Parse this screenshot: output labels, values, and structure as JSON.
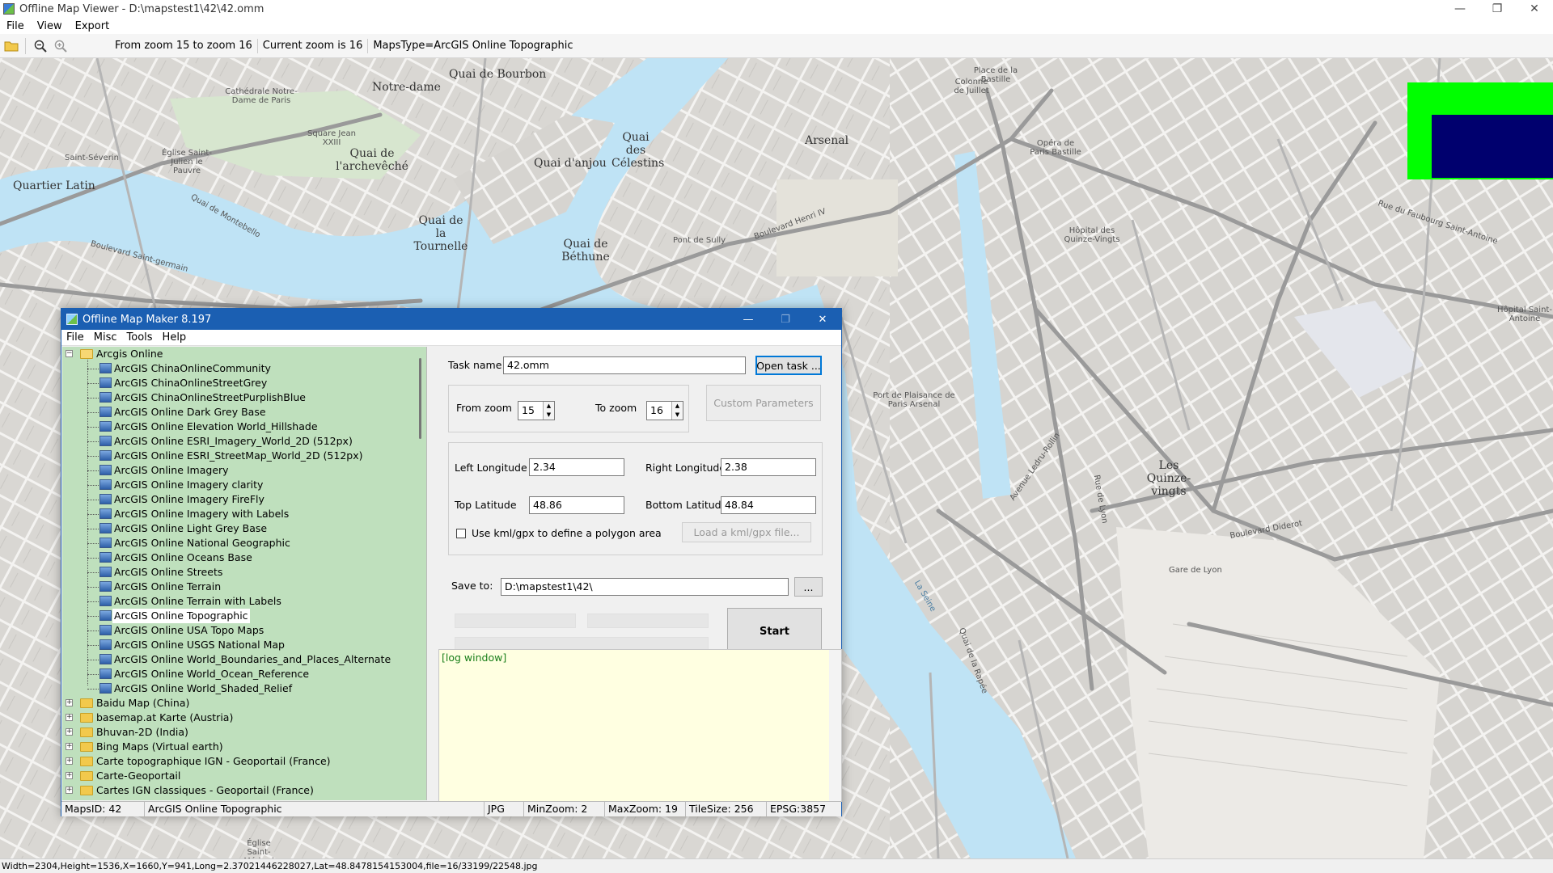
{
  "window": {
    "title": "Offline Map Viewer - D:\\mapstest1\\42\\42.omm",
    "controls": {
      "minimize": "—",
      "maximize": "❐",
      "close": "✕"
    }
  },
  "menu": [
    "File",
    "View",
    "Export"
  ],
  "toolbar": {
    "zoom_range": "From zoom 15 to zoom 16",
    "current_zoom": "Current zoom is 16",
    "maps_type": "MapsType=ArcGIS Online Topographic"
  },
  "map_labels": [
    "Notre-dame",
    "Quai de Bourbon",
    "Cathédrale Notre-Dame de Paris",
    "Square Jean XXIII",
    "Quai de l'archevêché",
    "Quai d'anjou",
    "Quai des Célestins",
    "Quai de la Tournelle",
    "Quai de Béthune",
    "Quartier Latin",
    "Saint-Séverin",
    "Église Saint-Julien le Pauvre",
    "Arsenal",
    "Opéra de Paris Bastille",
    "Hôpital des Quinze-Vingts",
    "Port de Plaisance de Paris Arsenal",
    "Les Quinze-vingts",
    "Gare de Lyon",
    "Hôpital Saint-Antoine",
    "Église Saint-Médard",
    "Pont de Sully",
    "La Seine",
    "Place de la Bastille",
    "Colonne de Juillet",
    "Boulevard Henri IV",
    "Boulevard Diderot",
    "Rue de Lyon",
    "Avenue Ledru-Rollin",
    "Quai de la Rapée",
    "Boulevard Saint-germain",
    "Quai de Montebello",
    "Rue du Faubourg Saint-Antoine"
  ],
  "statusbar": "Width=2304,Height=1536,X=1660,Y=941,Long=2.37021446228027,Lat=48.8478154153004,file=16/33199/22548.jpg",
  "dialog": {
    "title": "Offline Map Maker 8.197",
    "menu": [
      "File",
      "Misc",
      "Tools",
      "Help"
    ],
    "tree": {
      "root": "Arcgis Online",
      "children": [
        "ArcGIS ChinaOnlineCommunity",
        "ArcGIS ChinaOnlineStreetGrey",
        "ArcGIS ChinaOnlineStreetPurplishBlue",
        "ArcGIS Online Dark Grey Base",
        "ArcGIS Online Elevation World_Hillshade",
        "ArcGIS Online ESRI_Imagery_World_2D (512px)",
        "ArcGIS Online ESRI_StreetMap_World_2D (512px)",
        "ArcGIS Online Imagery",
        "ArcGIS Online Imagery clarity",
        "ArcGIS Online Imagery FireFly",
        "ArcGIS Online Imagery with Labels",
        "ArcGIS Online Light Grey Base",
        "ArcGIS Online National Geographic",
        "ArcGIS Online Oceans Base",
        "ArcGIS Online Streets",
        "ArcGIS Online Terrain",
        "ArcGIS Online Terrain with Labels",
        "ArcGIS Online Topographic",
        "ArcGIS Online USA Topo Maps",
        "ArcGIS Online USGS National Map",
        "ArcGIS Online World_Boundaries_and_Places_Alternate",
        "ArcGIS Online World_Ocean_Reference",
        "ArcGIS Online World_Shaded_Relief"
      ],
      "selected": "ArcGIS Online Topographic",
      "others": [
        "Baidu Map (China)",
        "basemap.at Karte (Austria)",
        "Bhuvan-2D (India)",
        "Bing Maps (Virtual earth)",
        "Carte topographique IGN - Geoportail (France)",
        "Carte-Geoportail",
        "Cartes IGN classiques - Geoportail (France)"
      ]
    },
    "form": {
      "task_name_label": "Task name",
      "task_name_value": "42.omm",
      "open_task_label": "Open task ...",
      "from_zoom_label": "From zoom",
      "from_zoom_value": "15",
      "to_zoom_label": "To zoom",
      "to_zoom_value": "16",
      "custom_params_label": "Custom Parameters",
      "left_lon_label": "Left Longitude",
      "left_lon_value": "2.34",
      "right_lon_label": "Right Longitude",
      "right_lon_value": "2.38",
      "top_lat_label": "Top Latitude",
      "top_lat_value": "48.86",
      "bottom_lat_label": "Bottom Latitude",
      "bottom_lat_value": "48.84",
      "kml_label": "Use kml/gpx to define a polygon area",
      "kml_checked": false,
      "load_kml_label": "Load a kml/gpx file...",
      "save_to_label": "Save to:",
      "save_to_value": "D:\\mapstest1\\42\\",
      "browse_label": "...",
      "start_label": "Start",
      "log_text": "[log window]"
    },
    "status": {
      "maps_id": "MapsID: 42",
      "map_name": "ArcGIS Online Topographic",
      "format": "JPG",
      "min_zoom": "MinZoom: 2",
      "max_zoom": "MaxZoom: 19",
      "tile_size": "TileSize: 256",
      "epsg": "EPSG:3857"
    }
  },
  "colors": {
    "water": "#bfe3f5",
    "blocks": "#d9d7d3",
    "roads": "#ffffff",
    "main_roads": "#999999",
    "tree_bg": "#bfe0bd",
    "dialog_title": "#1b5fb2",
    "log_bg": "#ffffe1",
    "legend_green": "#00ff00",
    "legend_navy": "#00006e"
  }
}
